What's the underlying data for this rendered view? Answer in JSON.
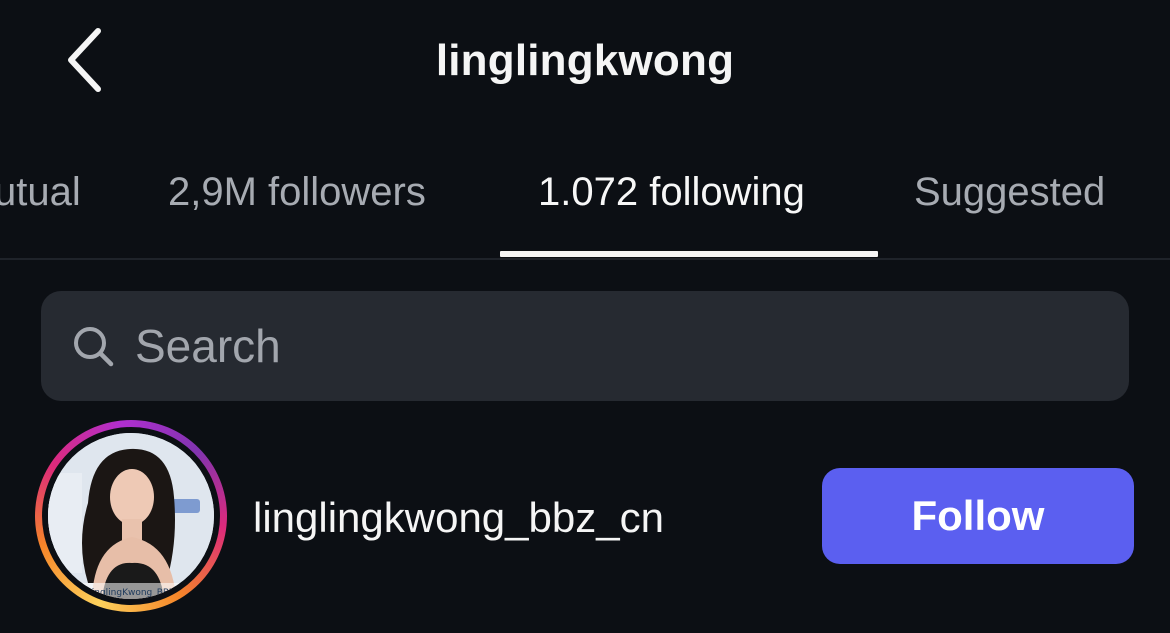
{
  "header": {
    "title": "linglingkwong"
  },
  "tabs": [
    {
      "label": "utual",
      "active": false
    },
    {
      "label": "2,9M followers",
      "active": false
    },
    {
      "label": "1.072 following",
      "active": true
    },
    {
      "label": "Suggested",
      "active": false
    }
  ],
  "search": {
    "placeholder": "Search",
    "value": ""
  },
  "users": [
    {
      "username": "linglingkwong_bbz_cn",
      "follow_label": "Follow",
      "avatar_watermark": "LinglingKwong_BBZ"
    }
  ],
  "colors": {
    "background": "#0c0f14",
    "search_bg": "#262a31",
    "follow_button": "#5b5ff0",
    "inactive_tab": "#a7abb2"
  }
}
